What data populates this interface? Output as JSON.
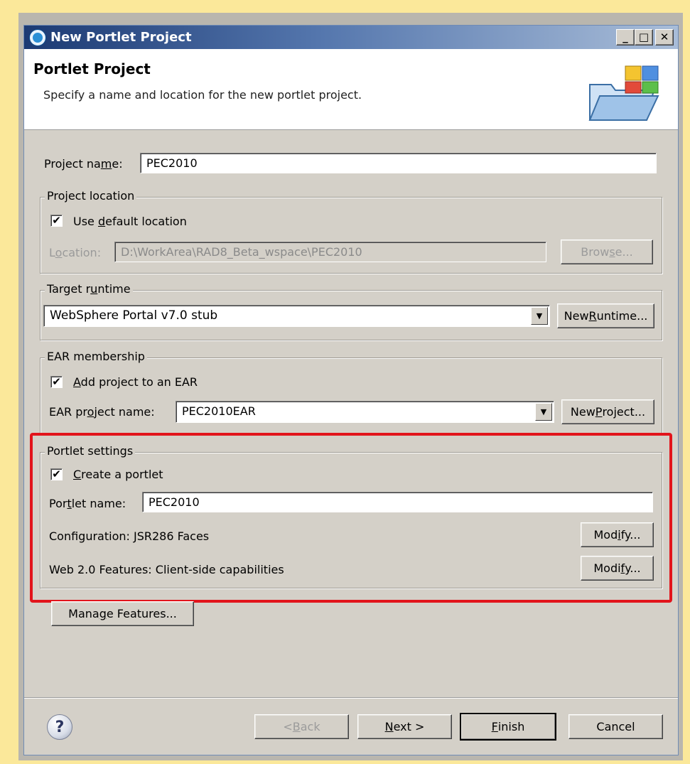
{
  "window": {
    "title": "New Portlet Project",
    "controls": {
      "minimize": "_",
      "maximize": "□",
      "close": "✕"
    }
  },
  "header": {
    "title": "Portlet Project",
    "description": "Specify a name and location for the new portlet project."
  },
  "project_name": {
    "label_pre": "Project na",
    "label_key": "m",
    "label_post": "e:",
    "value": "PEC2010"
  },
  "project_location": {
    "group_title": "Project location",
    "use_default": {
      "pre": "Use ",
      "key": "d",
      "post": "efault location",
      "checked": "✔"
    },
    "location_label": {
      "pre": "L",
      "key": "o",
      "post": "cation:"
    },
    "location_value": "D:\\WorkArea\\RAD8_Beta_wspace\\PEC2010",
    "browse": {
      "pre": "Brow",
      "key": "s",
      "post": "e..."
    }
  },
  "target_runtime": {
    "group_title": {
      "pre": "Target r",
      "key": "u",
      "post": "ntime"
    },
    "value": "WebSphere Portal v7.0 stub",
    "new_runtime": {
      "pre": "New ",
      "key": "R",
      "post": "untime..."
    }
  },
  "ear": {
    "group_title": "EAR membership",
    "add": {
      "pre": "",
      "key": "A",
      "post": "dd project to an EAR",
      "checked": "✔"
    },
    "name_label": {
      "pre": "EAR pr",
      "key": "o",
      "post": "ject name:"
    },
    "value": "PEC2010EAR",
    "new_project": {
      "pre": "New ",
      "key": "P",
      "post": "roject..."
    }
  },
  "portlet": {
    "group_title": "Portlet settings",
    "create": {
      "pre": "",
      "key": "C",
      "post": "reate a portlet",
      "checked": "✔"
    },
    "name_label": {
      "pre": "Por",
      "key": "t",
      "post": "let name:"
    },
    "name_value": "PEC2010",
    "configuration": "Configuration: JSR286 Faces",
    "modify1": {
      "pre": "Mod",
      "key": "i",
      "post": "fy..."
    },
    "web20": "Web 2.0 Features: Client-side capabilities",
    "modify2": {
      "pre": "Modi",
      "key": "f",
      "post": "y..."
    }
  },
  "manage_features": {
    "pre": "Mana",
    "key": "g",
    "post": "e Features..."
  },
  "footer": {
    "help": "?",
    "back": {
      "pre": "< ",
      "key": "B",
      "post": "ack"
    },
    "next": {
      "pre": "",
      "key": "N",
      "post": "ext >"
    },
    "finish": {
      "pre": "",
      "key": "F",
      "post": "inish"
    },
    "cancel": "Cancel"
  },
  "colors": {
    "highlight": "#e2141b",
    "background": "#fbe89a",
    "dialog": "#d4d0c8"
  }
}
